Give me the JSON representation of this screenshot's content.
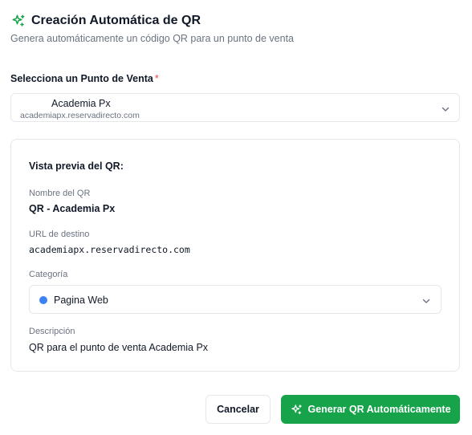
{
  "header": {
    "icon": "sparkles-icon",
    "title": "Creación Automática de QR",
    "subtitle": "Genera automáticamente un código QR para un punto de venta"
  },
  "point_of_sale": {
    "label": "Selecciona un Punto de Venta",
    "required_mark": "*",
    "selected_name": "Academia Px",
    "selected_domain": "academiapx.reservadirecto.com"
  },
  "preview": {
    "title": "Vista previa del QR:",
    "name_label": "Nombre del QR",
    "name_value": "QR - Academia Px",
    "url_label": "URL de destino",
    "url_value": "academiapx.reservadirecto.com",
    "category_label": "Categoría",
    "category_value": "Pagina Web",
    "category_color": "#3b82f6",
    "description_label": "Descripción",
    "description_value": "QR para el punto de venta Academia Px"
  },
  "actions": {
    "cancel_label": "Cancelar",
    "generate_label": "Generar QR Automáticamente",
    "generate_icon": "sparkles-icon",
    "generate_color": "#16a34a"
  }
}
